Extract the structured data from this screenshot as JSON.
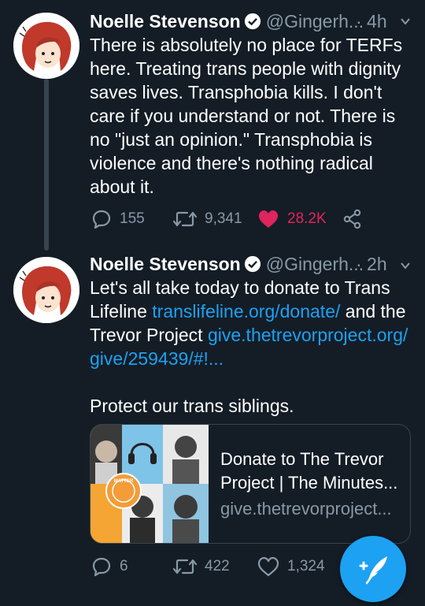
{
  "tweets": [
    {
      "author_name": "Noelle Stevenson",
      "handle": "@Gingerh...",
      "time": "· 4h",
      "lines": [
        "There is absolutely no place for TERFs",
        "here. Treating trans people with dignity",
        "saves lives. Transphobia kills. I don't",
        "care if you understand or not. There is",
        "no \"just an opinion.\" Transphobia is",
        "violence and there's nothing radical",
        "about it."
      ],
      "replies": "155",
      "retweets": "9,341",
      "likes": "28.2K",
      "liked": true
    },
    {
      "author_name": "Noelle Stevenson",
      "handle": "@Gingerh...",
      "time": "· 2h",
      "line1": "Let's all take today to donate to Trans",
      "line2_text": "Lifeline ",
      "line2_link": "translifeline.org/donate/",
      "line2_tail": " and the",
      "line3_text": "Trevor Project ",
      "line3_link": "give.thetrevorproject.org/",
      "line4_link": "give/259439/#!...",
      "line5": "Protect our trans siblings.",
      "card": {
        "title_line1": "Donate to The Trevor",
        "title_line2": "Project | The Minutes...",
        "domain": "give.thetrevorproject...",
        "badge_text": "MATTER"
      },
      "replies": "6",
      "retweets": "422",
      "likes": "1,324"
    }
  ],
  "colors": {
    "background": "#141d26",
    "secondary_text": "#8899a6",
    "link": "#1da1f2",
    "like": "#e0245e",
    "divider": "#38444d"
  },
  "icons": [
    "verified-icon",
    "chevron-down-icon",
    "reply-icon",
    "retweet-icon",
    "like-icon",
    "share-icon",
    "compose-tweet-icon"
  ]
}
